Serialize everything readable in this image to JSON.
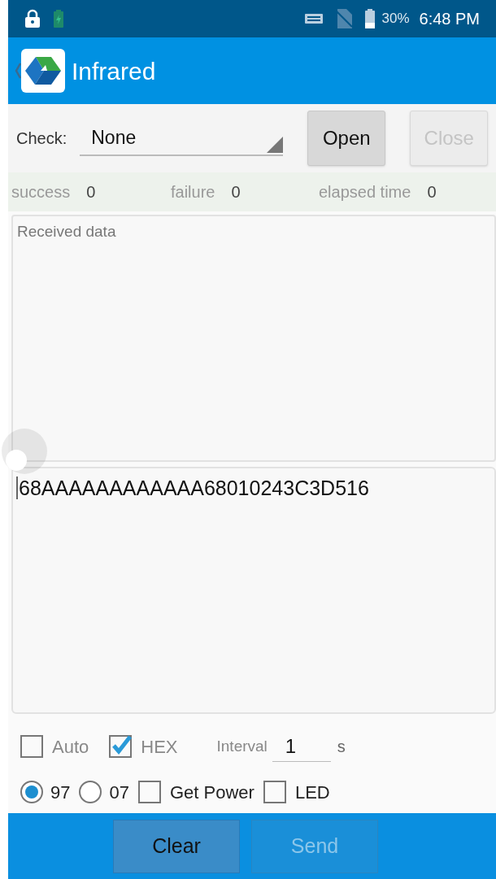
{
  "status_bar": {
    "battery": "30%",
    "time": "6:48 PM"
  },
  "app_bar": {
    "title": "Infrared"
  },
  "check": {
    "label": "Check:",
    "value": "None"
  },
  "actions": [
    {
      "label": "Open",
      "disabled": false
    },
    {
      "label": "Close",
      "disabled": true
    }
  ],
  "stats": [
    {
      "label": "success",
      "value": "0"
    },
    {
      "label": "failure",
      "value": "0"
    },
    {
      "label": "elapsed time",
      "value": "0"
    }
  ],
  "received": {
    "placeholder": "Received data"
  },
  "send_field": {
    "value": "68AAAAAAAAAAAA68010243C3D516"
  },
  "options_row_1": [
    {
      "kind": "checkbox",
      "label": "Auto",
      "checked": false
    },
    {
      "kind": "checkbox",
      "label": "HEX",
      "checked": true
    },
    {
      "kind": "field",
      "label": "Interval",
      "value": "1",
      "unit": "s"
    }
  ],
  "options_row_2": [
    {
      "kind": "radio",
      "label": "97",
      "selected": true
    },
    {
      "kind": "radio",
      "label": "07",
      "selected": false
    },
    {
      "kind": "checkbox",
      "label": "Get Power",
      "checked": false
    },
    {
      "kind": "checkbox",
      "label": "LED",
      "checked": false
    }
  ],
  "bottom_buttons": [
    {
      "label": "Clear",
      "disabled": false
    },
    {
      "label": "Send",
      "disabled": true
    }
  ]
}
